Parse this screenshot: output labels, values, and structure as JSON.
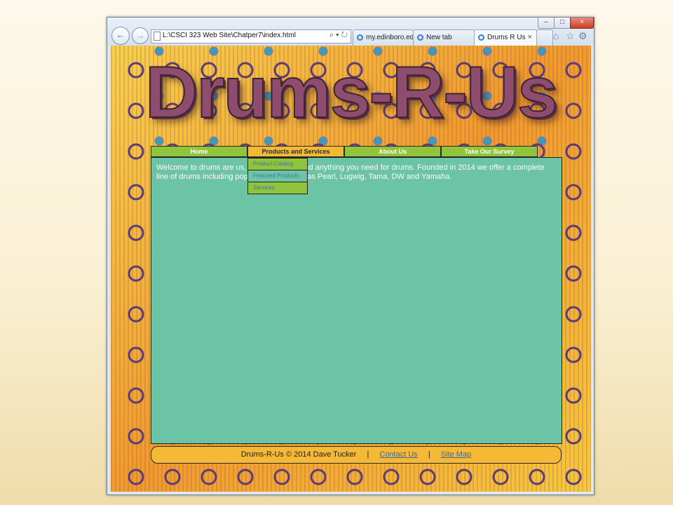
{
  "browser": {
    "address_url": "L:\\CSCI 323 Web Site\\Chatper7\\index.html",
    "address_tools": "⌕ ▾ ↻",
    "tabs": [
      {
        "label": "my.edinboro.edu"
      },
      {
        "label": "New tab"
      },
      {
        "label": "Drums R Us",
        "close": "×"
      }
    ],
    "controls": {
      "minimize": "–",
      "maximize": "□",
      "close": "×"
    },
    "nav": {
      "back": "←",
      "forward": "→"
    },
    "toolbar_icons": {
      "home": "⌂",
      "favorites": "☆",
      "settings": "⚙"
    }
  },
  "site": {
    "logo_text": "Drums-R-Us",
    "menu": {
      "home": "Home",
      "products": "Products and Services",
      "about": "About Us",
      "survey": "Take Our Survey"
    },
    "dropdown": [
      "Product Catalog",
      "Featured Products",
      "Services"
    ],
    "content": {
      "intro": "Welcome to drums are us, where you can find anything you need for drums. Founded in 2014 we offer a complete line of drums including popular brands such as Pearl, Lugwig, Tama, DW and Yamaha."
    },
    "footer": {
      "copyright": "Drums-R-Us © 2014 Dave Tucker",
      "separator": "|",
      "contact": "Contact Us",
      "sitemap": "Site Map"
    }
  }
}
